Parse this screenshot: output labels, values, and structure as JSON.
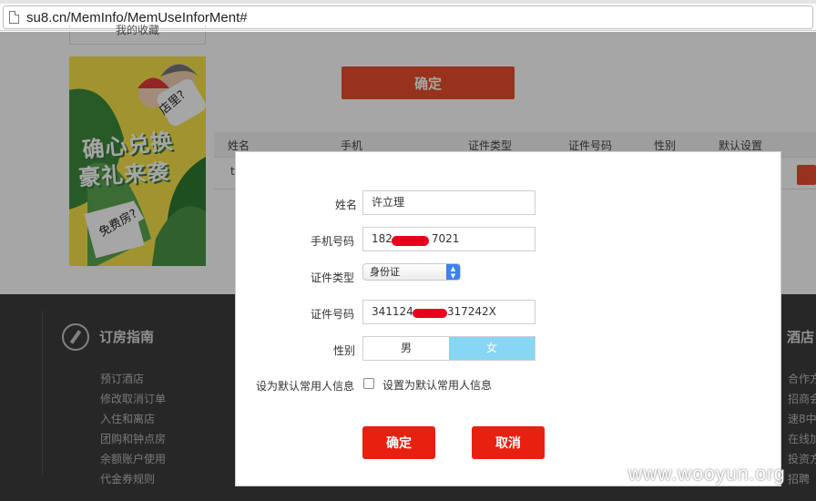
{
  "browser": {
    "url": "su8.cn/MemInfo/MemUseInforMent#"
  },
  "background": {
    "side_box_text": "我的收藏",
    "poster": {
      "title_line1": "确心兑换",
      "title_line2": "豪礼来袭",
      "bubble": "店里?",
      "tag": "免费房?"
    },
    "confirm_label": "确定",
    "table_headers": [
      "姓名",
      "手机",
      "证件类型",
      "证件号码",
      "性别",
      "默认设置"
    ],
    "row_fragment": "t",
    "footer": {
      "heading": "订房指南",
      "links": [
        "预订酒店",
        "修改取消订单",
        "入住和离店",
        "团购和钟点房",
        "余额账户使用",
        "代金券规则"
      ],
      "heading_right": "酒店",
      "links_right": [
        "合作方",
        "招商会",
        "速8中",
        "在线加",
        "投资方",
        "招聘"
      ]
    }
  },
  "modal": {
    "name_label": "姓名",
    "name_value": "许立理",
    "phone_label": "手机号码",
    "phone_prefix": "182",
    "phone_suffix": "7021",
    "id_type_label": "证件类型",
    "id_type_value": "身份证",
    "id_number_label": "证件号码",
    "id_prefix": "341124",
    "id_suffix": "317242X",
    "gender_label": "性别",
    "gender_male": "男",
    "gender_female": "女",
    "gender_selected": "女",
    "default_label": "设为默认常用人信息",
    "default_checkbox_label": "设置为默认常用人信息",
    "default_checked": false,
    "confirm_label": "确定",
    "cancel_label": "取消"
  },
  "watermark": "www.wooyun.org",
  "colors": {
    "accent_red": "#e8200f",
    "button_orange": "#e84d2c",
    "selected_gender": "#86d6f4",
    "footer_bg": "#3c3c3c",
    "redaction": "#e8001c"
  }
}
